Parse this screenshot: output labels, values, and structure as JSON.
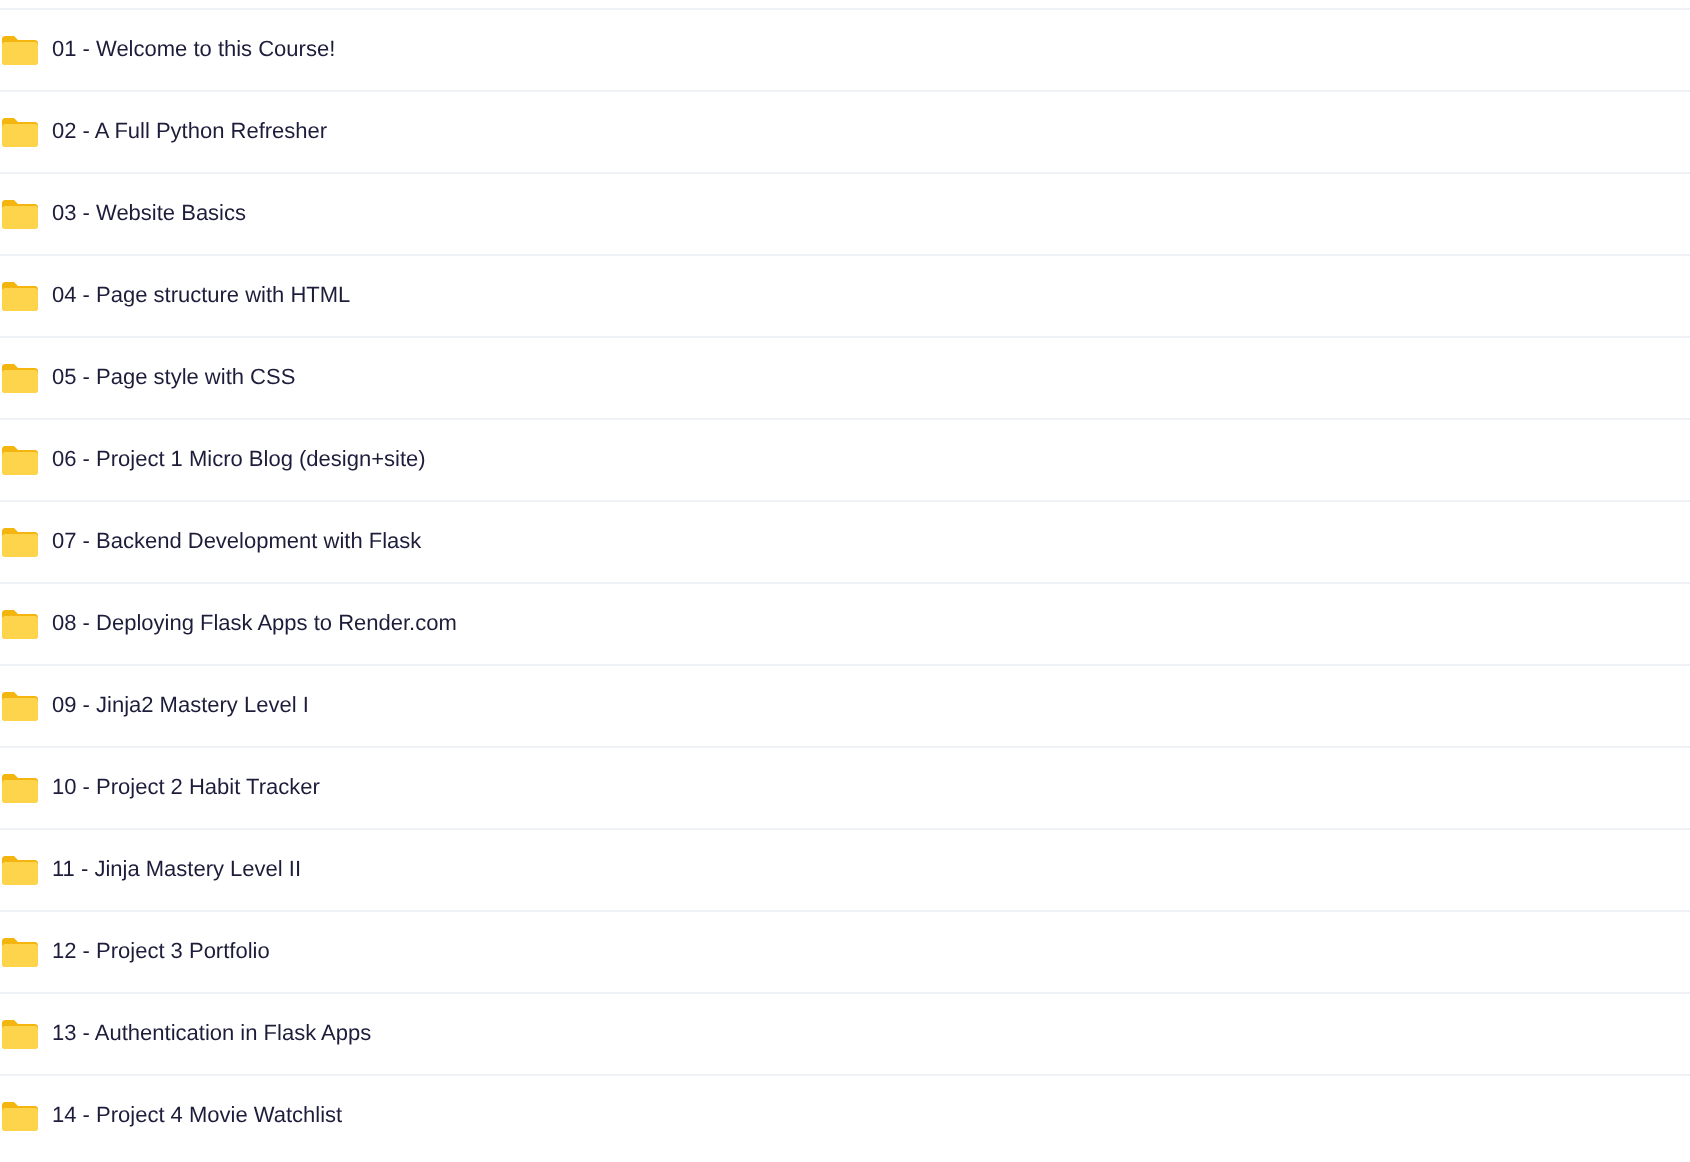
{
  "folders": [
    {
      "name": "01 - Welcome to this Course!"
    },
    {
      "name": "02 - A Full Python Refresher"
    },
    {
      "name": "03 - Website Basics"
    },
    {
      "name": "04 - Page structure with HTML"
    },
    {
      "name": "05 - Page style with CSS"
    },
    {
      "name": "06 - Project 1 Micro Blog (design+site)"
    },
    {
      "name": "07 - Backend Development with Flask"
    },
    {
      "name": "08 - Deploying Flask Apps to Render.com"
    },
    {
      "name": "09 - Jinja2 Mastery Level I"
    },
    {
      "name": "10 - Project 2 Habit Tracker"
    },
    {
      "name": "11 - Jinja Mastery Level II"
    },
    {
      "name": "12 - Project 3 Portfolio"
    },
    {
      "name": "13 - Authentication in Flask Apps"
    },
    {
      "name": "14 - Project 4 Movie Watchlist"
    }
  ]
}
